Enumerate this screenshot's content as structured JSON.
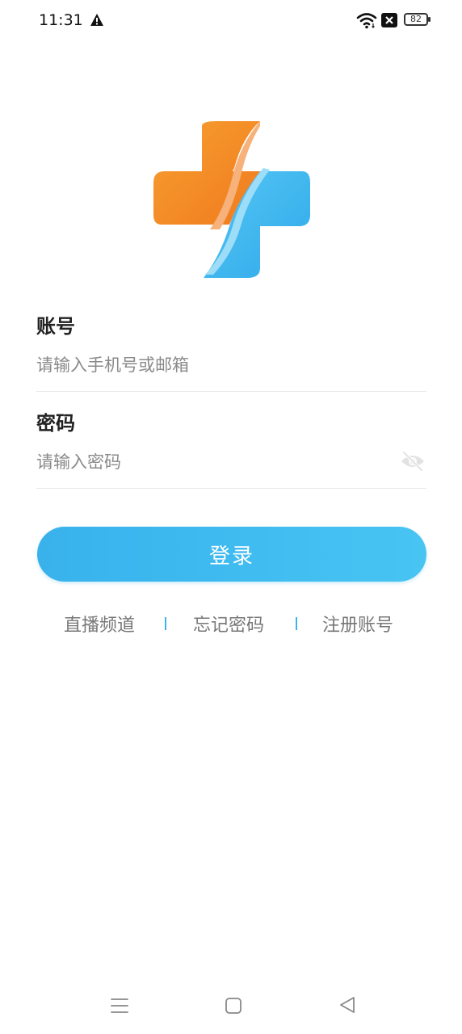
{
  "status_bar": {
    "time": "11:31",
    "battery": "82",
    "icons": [
      "warning-icon",
      "wifi-icon",
      "x-box-icon",
      "battery-icon"
    ]
  },
  "logo": {
    "icon": "medical-cross-logo",
    "colors": {
      "orange": "#F5892A",
      "blue": "#3AB4EE"
    }
  },
  "form": {
    "account_label": "账号",
    "account_placeholder": "请输入手机号或邮箱",
    "account_value": "",
    "password_label": "密码",
    "password_placeholder": "请输入密码",
    "password_value": "",
    "password_toggle_icon": "eye-off-icon"
  },
  "login_button": {
    "label": "登录",
    "color": "#3AB4EE"
  },
  "links": {
    "live": "直播频道",
    "forgot": "忘记密码",
    "register": "注册账号",
    "separator": "|"
  },
  "nav_bar": {
    "icons": [
      "menu-icon",
      "home-icon",
      "back-icon"
    ]
  }
}
